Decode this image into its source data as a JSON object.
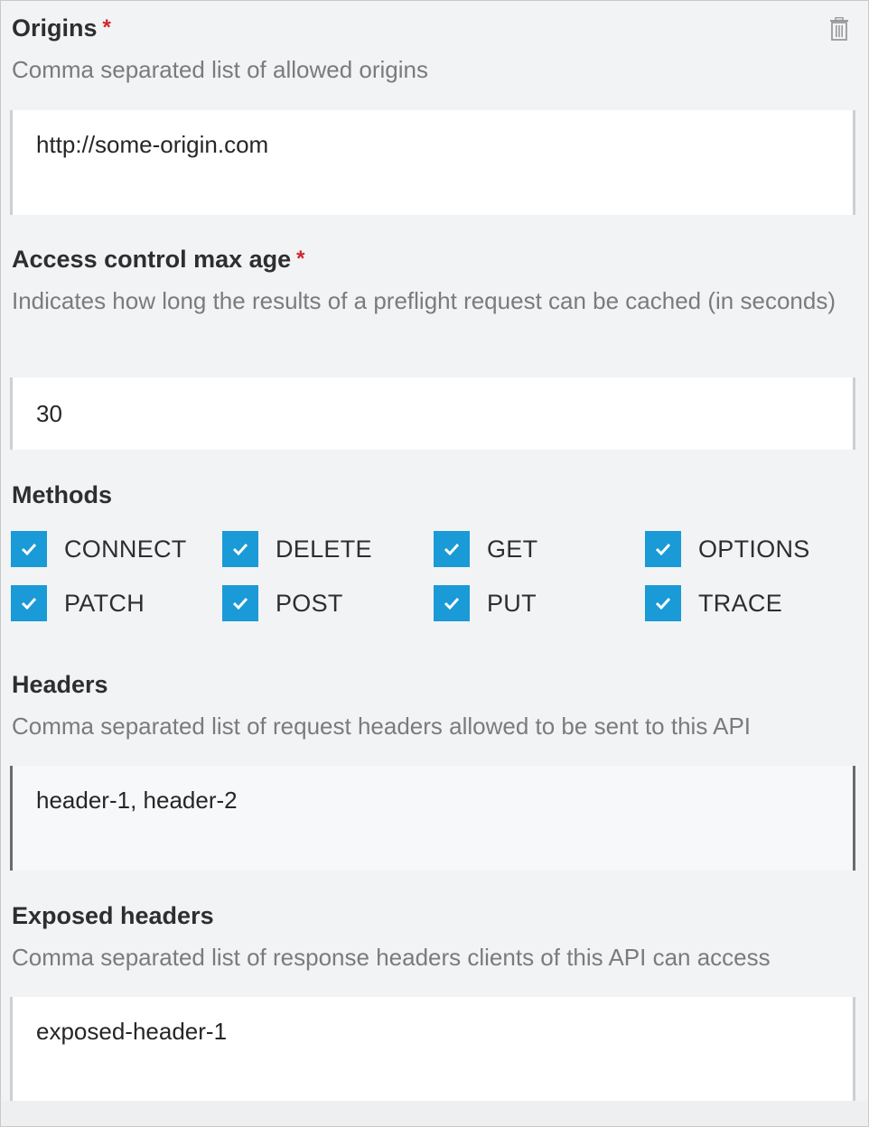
{
  "origins": {
    "label": "Origins",
    "required_mark": "*",
    "description": "Comma separated list of allowed origins",
    "value": "http://some-origin.com"
  },
  "max_age": {
    "label": "Access control max age",
    "required_mark": "*",
    "description": "Indicates how long the results of a preflight request can be cached (in seconds)",
    "value": "30"
  },
  "methods": {
    "label": "Methods",
    "items": [
      {
        "label": "CONNECT",
        "checked": true
      },
      {
        "label": "DELETE",
        "checked": true
      },
      {
        "label": "GET",
        "checked": true
      },
      {
        "label": "OPTIONS",
        "checked": true
      },
      {
        "label": "PATCH",
        "checked": true
      },
      {
        "label": "POST",
        "checked": true
      },
      {
        "label": "PUT",
        "checked": true
      },
      {
        "label": "TRACE",
        "checked": true
      }
    ]
  },
  "headers": {
    "label": "Headers",
    "description": "Comma separated list of request headers allowed to be sent to this API",
    "value": "header-1, header-2"
  },
  "exposed_headers": {
    "label": "Exposed headers",
    "description": "Comma separated list of response headers clients of this API can access",
    "value": "exposed-header-1"
  },
  "icons": {
    "delete": "trash-icon",
    "check": "checkmark-icon"
  },
  "colors": {
    "checkbox_accent": "#1a9ad6",
    "required": "#d0262d"
  }
}
